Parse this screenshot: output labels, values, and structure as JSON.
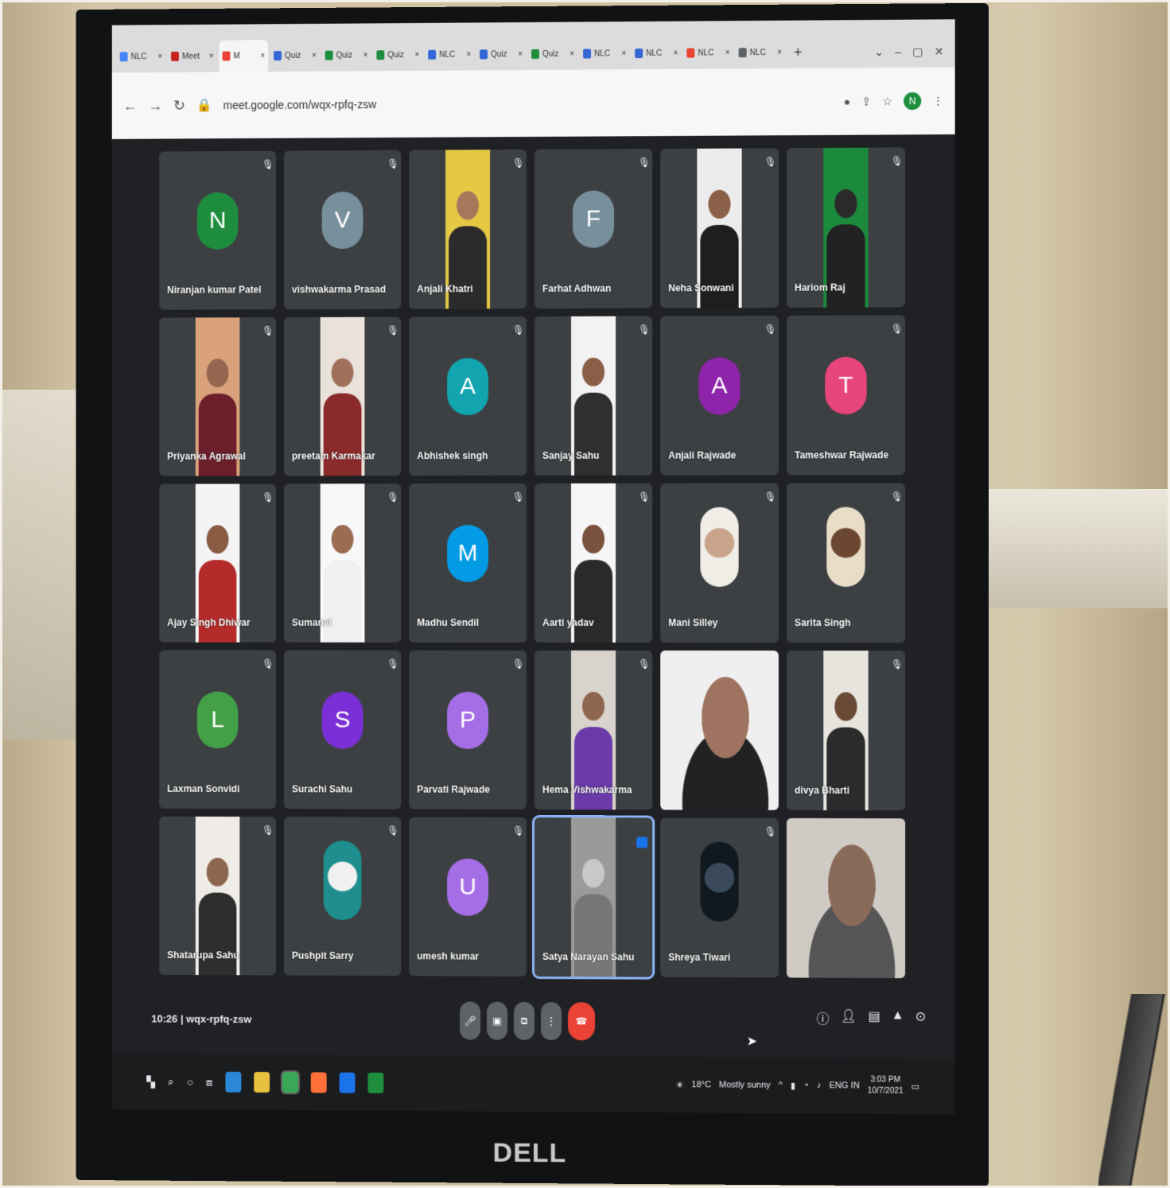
{
  "monitor": {
    "brand": "DELL"
  },
  "browser": {
    "tabs": [
      {
        "label": "NLC",
        "color": "#4285f4"
      },
      {
        "label": "Meet",
        "color": "#c5221f"
      },
      {
        "label": "M",
        "color": "#ea4335"
      },
      {
        "label": "Quiz",
        "color": "#3367d6"
      },
      {
        "label": "Quiz",
        "color": "#1e8e3e"
      },
      {
        "label": "Quiz",
        "color": "#1e8e3e"
      },
      {
        "label": "NLC",
        "color": "#3367d6"
      },
      {
        "label": "Quiz",
        "color": "#3367d6"
      },
      {
        "label": "Quiz",
        "color": "#1e8e3e"
      },
      {
        "label": "NLC",
        "color": "#3367d6"
      },
      {
        "label": "NLC",
        "color": "#3367d6"
      },
      {
        "label": "NLC",
        "color": "#ea4335"
      },
      {
        "label": "NLC",
        "color": "#5f6368"
      }
    ],
    "new_tab": "+",
    "url": "meet.google.com/wqx-rpfq-zsw",
    "account_initial": "N"
  },
  "participants": [
    {
      "name": "Niranjan kumar Patel",
      "type": "initial",
      "initial": "N",
      "color": "#1e8e3e"
    },
    {
      "name": "vishwakarma Prasad",
      "type": "initial",
      "initial": "V",
      "color": "#78909c"
    },
    {
      "name": "Anjali Khatri",
      "type": "photo",
      "bg": "#e5c844",
      "skin": "#a6785b",
      "cloth": "#2b2b2b"
    },
    {
      "name": "Farhat Adhwan",
      "type": "initial",
      "initial": "F",
      "color": "#78909c"
    },
    {
      "name": "Neha Sonwani",
      "type": "photo",
      "bg": "#ececec",
      "skin": "#8a6049",
      "cloth": "#1e1e1e"
    },
    {
      "name": "Hariom Raj",
      "type": "photo",
      "bg": "#1c8a3c",
      "skin": "#2a2a2a",
      "cloth": "#222"
    },
    {
      "name": "Priyanka Agrawal",
      "type": "photo",
      "bg": "#d9a27a",
      "skin": "#946650",
      "cloth": "#6c1f2b"
    },
    {
      "name": "preetam Karmakar",
      "type": "photo",
      "bg": "#e8e2da",
      "skin": "#a0705a",
      "cloth": "#8b2a2a"
    },
    {
      "name": "Abhishek singh",
      "type": "initial",
      "initial": "A",
      "color": "#12a4af"
    },
    {
      "name": "Sanjay Sahu",
      "type": "photo",
      "bg": "#f2f2f2",
      "skin": "#8a5f47",
      "cloth": "#2f2f2f"
    },
    {
      "name": "Anjali Rajwade",
      "type": "initial",
      "initial": "A",
      "color": "#8e24aa"
    },
    {
      "name": "Tameshwar Rajwade",
      "type": "initial",
      "initial": "T",
      "color": "#e8457a"
    },
    {
      "name": "Ajay Singh Dhiwar",
      "type": "photo",
      "bg": "#f4f4f4",
      "skin": "#8a5c44",
      "cloth": "#b52b2b"
    },
    {
      "name": "Sumanvi",
      "type": "photo",
      "bg": "#f8f8f8",
      "skin": "#9b6c52",
      "cloth": "#f0f0f0"
    },
    {
      "name": "Madhu Sendil",
      "type": "initial",
      "initial": "M",
      "color": "#039be5"
    },
    {
      "name": "Aarti yadav",
      "type": "photo",
      "bg": "#f6f6f6",
      "skin": "#7a513c",
      "cloth": "#2a2a2a"
    },
    {
      "name": "Mani Silley",
      "type": "round",
      "bg": "#f0ece6",
      "skin": "#c9a48a"
    },
    {
      "name": "Sarita Singh",
      "type": "round",
      "bg": "#e9ddc8",
      "skin": "#6b4630"
    },
    {
      "name": "Laxman Sonvidi",
      "type": "initial",
      "initial": "L",
      "color": "#43a047"
    },
    {
      "name": "Surachi Sahu",
      "type": "initial",
      "initial": "S",
      "color": "#7b2fd6"
    },
    {
      "name": "Parvati Rajwade",
      "type": "initial",
      "initial": "P",
      "color": "#a56ee6"
    },
    {
      "name": "Hema Vishwakarma",
      "type": "photo",
      "bg": "#d8d3cc",
      "skin": "#8e6650",
      "cloth": "#6a3aa8"
    },
    {
      "name": "",
      "type": "big",
      "bg": "#efefef",
      "skin": "#9e7460",
      "cloth": "#222"
    },
    {
      "name": "divya Bharti",
      "type": "photo",
      "bg": "#e7e3dd",
      "skin": "#6a4a36",
      "cloth": "#2b2b2b"
    },
    {
      "name": "Shatarupa Sahu",
      "type": "photo",
      "bg": "#efece8",
      "skin": "#8d6650",
      "cloth": "#2e2e2e"
    },
    {
      "name": "Pushpit Sarry",
      "type": "round",
      "bg": "#1e8e8e",
      "skin": "#f0f0f0"
    },
    {
      "name": "umesh kumar",
      "type": "initial",
      "initial": "U",
      "color": "#a56ee6"
    },
    {
      "name": "Satya Narayan Sahu",
      "type": "photo",
      "bg": "#9a9a9a",
      "skin": "#c8c8c8",
      "cloth": "#777"
    },
    {
      "name": "Shreya Tiwari",
      "type": "round",
      "bg": "#101820",
      "skin": "#3a4a5a"
    },
    {
      "name": "",
      "type": "big",
      "bg": "#cfcac4",
      "skin": "#8a6a58",
      "cloth": "#555"
    }
  ],
  "selected_index": 27,
  "meeting": {
    "time": "10:26",
    "code": "wqx-rpfq-zsw"
  },
  "taskbar": {
    "weather": "18°C",
    "weather_text": "Mostly sunny",
    "lang": "ENG IN",
    "time": "3:03 PM",
    "date": "10/7/2021"
  }
}
